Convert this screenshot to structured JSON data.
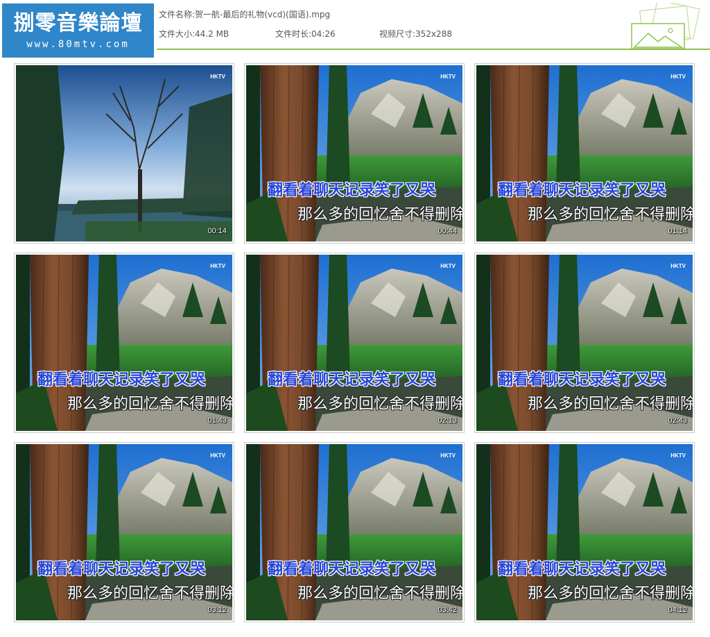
{
  "logo": {
    "title": "捌零音樂論壇",
    "subtitle": "www.80mtv.com"
  },
  "file_info": {
    "name_label": "文件名称:",
    "name_value": "贺一航-最后的礼物(vcd)(国语).mpg",
    "size_label": "文件大小:",
    "size_value": "44.2 MB",
    "duration_label": "文件时长:",
    "duration_value": "04:26",
    "resolution_label": "视频尺寸:",
    "resolution_value": "352x288"
  },
  "colors": {
    "logo_bg": "#2f86c9",
    "header_line": "#8bc34a",
    "lyric_primary": "#2846d8"
  },
  "thumbnails": [
    {
      "scene": "tree-lake",
      "watermark": "HKTV",
      "lyric_line1": "",
      "lyric_line2": "",
      "timestamp": "00:14"
    },
    {
      "scene": "forest-mountain",
      "watermark": "HKTV",
      "lyric_line1": "翻看着聊天记录笑了又哭",
      "lyric_line2": "那么多的回忆舍不得删除",
      "timestamp": "00:44"
    },
    {
      "scene": "forest-mountain",
      "watermark": "HKTV",
      "lyric_line1": "翻看着聊天记录笑了又哭",
      "lyric_line2": "那么多的回忆舍不得删除",
      "timestamp": "01:14"
    },
    {
      "scene": "forest-mountain",
      "watermark": "HKTV",
      "lyric_line1": "翻看着聊天记录笑了又哭",
      "lyric_line2": "那么多的回忆舍不得删除",
      "timestamp": "01:43"
    },
    {
      "scene": "forest-mountain",
      "watermark": "HKTV",
      "lyric_line1": "翻看着聊天记录笑了又哭",
      "lyric_line2": "那么多的回忆舍不得删除",
      "timestamp": "02:13"
    },
    {
      "scene": "forest-mountain",
      "watermark": "HKTV",
      "lyric_line1": "翻看着聊天记录笑了又哭",
      "lyric_line2": "那么多的回忆舍不得删除",
      "timestamp": "02:43"
    },
    {
      "scene": "forest-mountain",
      "watermark": "HKTV",
      "lyric_line1": "翻看着聊天记录笑了又哭",
      "lyric_line2": "那么多的回忆舍不得删除",
      "timestamp": "03:12"
    },
    {
      "scene": "forest-mountain",
      "watermark": "HKTV",
      "lyric_line1": "翻看着聊天记录笑了又哭",
      "lyric_line2": "那么多的回忆舍不得删除",
      "timestamp": "03:42"
    },
    {
      "scene": "forest-mountain",
      "watermark": "HKTV",
      "lyric_line1": "翻看着聊天记录笑了又哭",
      "lyric_line2": "那么多的回忆舍不得删除",
      "timestamp": "04:12"
    }
  ]
}
